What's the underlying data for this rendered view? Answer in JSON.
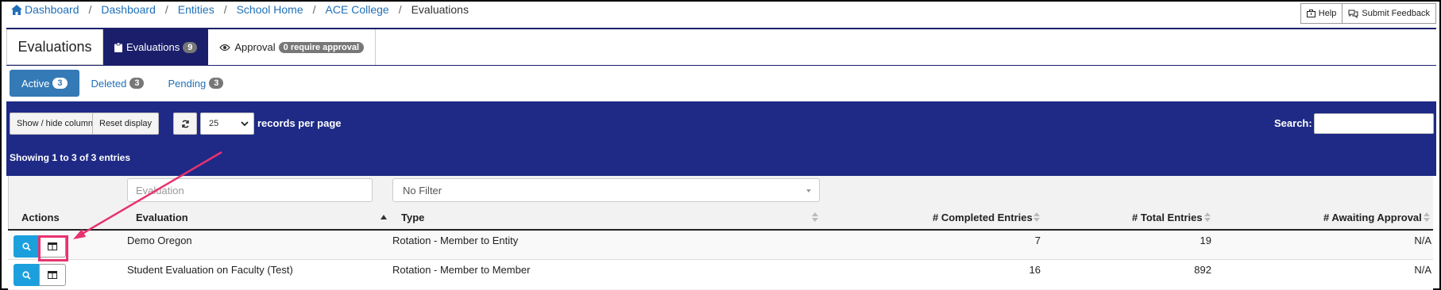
{
  "breadcrumb": {
    "items": [
      "Dashboard",
      "Dashboard",
      "Entities",
      "School Home",
      "ACE College"
    ],
    "separator": "/",
    "current": "Evaluations"
  },
  "top_actions": {
    "help": "Help",
    "feedback": "Submit Feedback"
  },
  "tabs": {
    "title": "Evaluations",
    "evaluations_label": "Evaluations",
    "evaluations_count": "9",
    "approval_label": "Approval",
    "approval_badge": "0 require approval"
  },
  "subtabs": [
    {
      "label": "Active",
      "count": "3"
    },
    {
      "label": "Deleted",
      "count": "3"
    },
    {
      "label": "Pending",
      "count": "3"
    }
  ],
  "toolbar": {
    "show_hide": "Show / hide columns",
    "reset": "Reset display",
    "per_page": "25",
    "records_label": "records per page",
    "search_label": "Search:"
  },
  "showing": "Showing 1 to 3 of 3 entries",
  "filters": {
    "evaluation_placeholder": "Evaluation",
    "type_value": "No Filter"
  },
  "columns": [
    "Actions",
    "Evaluation",
    "Type",
    "# Completed Entries",
    "# Total Entries",
    "# Awaiting Approval"
  ],
  "rows": [
    {
      "evaluation": "Demo Oregon",
      "type": "Rotation - Member to Entity",
      "completed": "7",
      "total": "19",
      "awaiting": "N/A"
    },
    {
      "evaluation": "Student Evaluation on Faculty (Test)",
      "type": "Rotation - Member to Member",
      "completed": "16",
      "total": "892",
      "awaiting": "N/A"
    }
  ],
  "colors": {
    "navy": "#1b1f6b",
    "panel": "#1e2a86",
    "link": "#1f6fb8",
    "accent": "#1ba0dd",
    "highlight": "#e8336d"
  }
}
